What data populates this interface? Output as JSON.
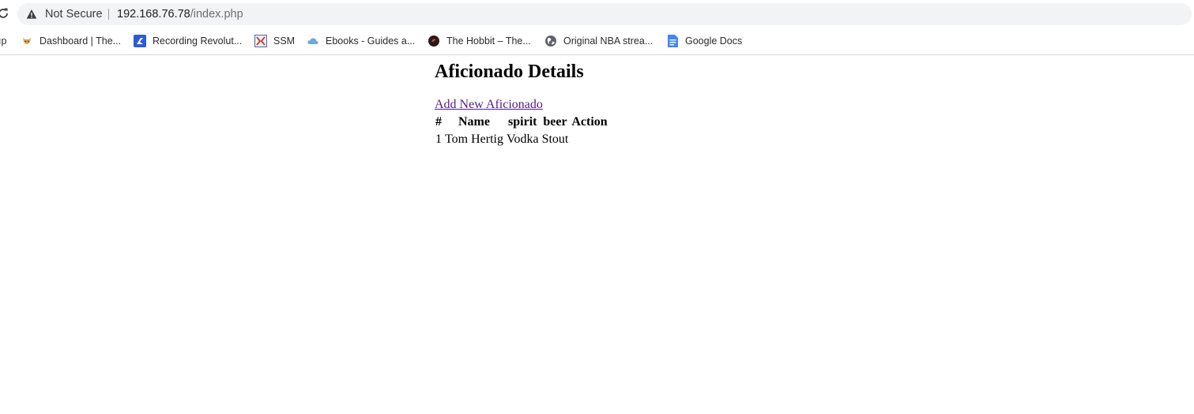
{
  "browser": {
    "security_label": "Not Secure",
    "url_host": "192.168.76.78",
    "url_path": "/index.php",
    "bookmarks": [
      {
        "label": "ıp",
        "icon": "clipped-icon"
      },
      {
        "label": "Dashboard | The...",
        "icon": "cat-icon"
      },
      {
        "label": "Recording Revolut...",
        "icon": "r-logo-icon"
      },
      {
        "label": "SSM",
        "icon": "ssm-icon"
      },
      {
        "label": "Ebooks - Guides a...",
        "icon": "cloud-icon"
      },
      {
        "label": "The Hobbit – The...",
        "icon": "hobbit-icon"
      },
      {
        "label": "Original NBA strea...",
        "icon": "globe-icon"
      },
      {
        "label": "Google Docs",
        "icon": "docs-icon"
      }
    ]
  },
  "page": {
    "title": "Aficionado Details",
    "add_link": "Add New Aficionado",
    "table": {
      "headers": [
        "#",
        "Name",
        "spirit",
        "beer",
        "Action"
      ],
      "rows": [
        [
          "1",
          "Tom Hertig",
          "Vodka",
          "Stout",
          ""
        ]
      ]
    }
  },
  "colors": {
    "link_visited": "#551a8b",
    "address_bar_bg": "#f1f3f4"
  }
}
